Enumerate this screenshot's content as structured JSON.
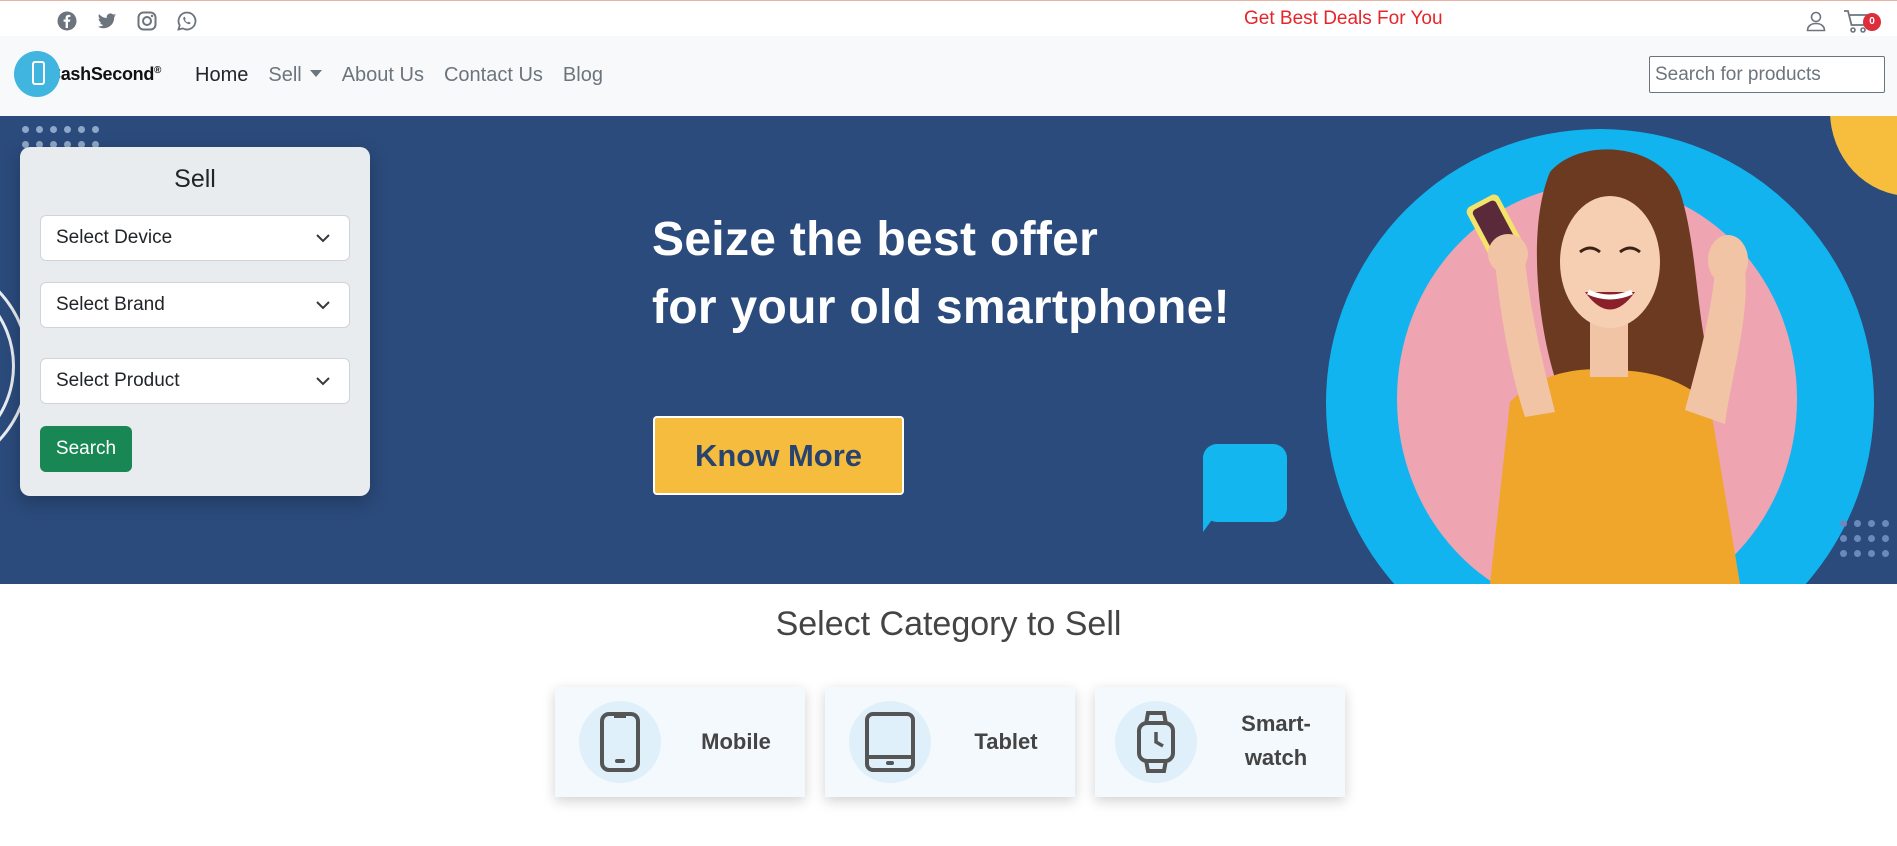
{
  "topbar": {
    "social_icons": [
      "facebook-icon",
      "twitter-icon",
      "instagram-icon",
      "whatsapp-icon"
    ],
    "promo_text": "Get Best Deals For You",
    "cart_count": "0"
  },
  "brand": {
    "name": "CashSecond",
    "reg": "®"
  },
  "nav": {
    "home": "Home",
    "sell": "Sell",
    "about": "About Us",
    "contact": "Contact Us",
    "blog": "Blog"
  },
  "search": {
    "placeholder": "Search for products"
  },
  "hero": {
    "headline_line1": "Seize the best offer",
    "headline_line2": "for your old smartphone!",
    "cta": "Know More"
  },
  "sell_form": {
    "title": "Sell",
    "device": "Select Device",
    "brand": "Select Brand",
    "product": "Select Product",
    "search": "Search"
  },
  "categories": {
    "title": "Select Category to Sell",
    "items": [
      {
        "label": "Mobile",
        "icon": "mobile-icon"
      },
      {
        "label": "Tablet",
        "icon": "tablet-icon"
      },
      {
        "label_line1": "Smart-",
        "label_line2": "watch",
        "icon": "smartwatch-icon"
      }
    ]
  },
  "colors": {
    "hero_bg": "#2b4b7c",
    "accent_yellow": "#f5bc3e",
    "accent_blue": "#12b4ef",
    "promo_red": "#e5252a",
    "search_green": "#198754"
  }
}
